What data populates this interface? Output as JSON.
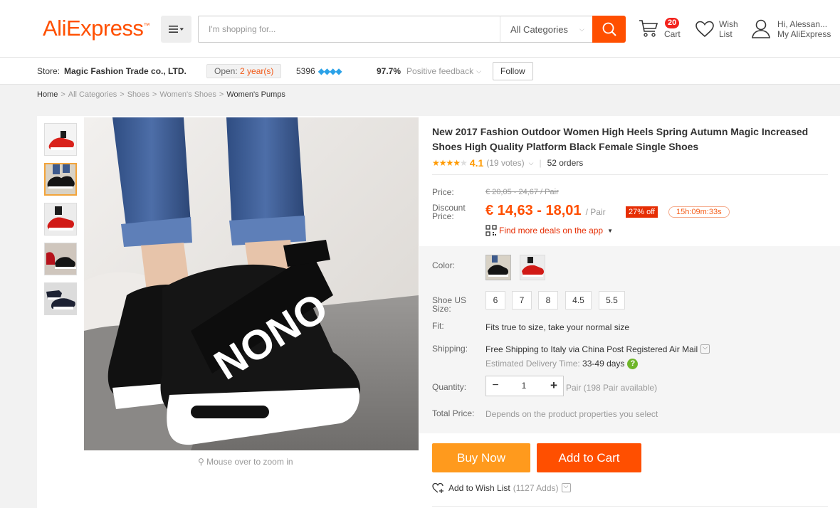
{
  "header": {
    "logo": "AliExpress",
    "search_placeholder": "I'm shopping for...",
    "search_category": "All Categories",
    "cart_count": "20",
    "cart_label": "Cart",
    "wish_line1": "Wish",
    "wish_line2": "List",
    "account_line1": "Hi, Alessan...",
    "account_line2": "My AliExpress"
  },
  "store": {
    "label": "Store:",
    "name": "Magic Fashion Trade co., LTD.",
    "open_prefix": "Open:",
    "open_years": "2 year(s)",
    "score": "5396",
    "diamonds": "💎💎💎💎",
    "feedback_pct": "97.7%",
    "feedback_label": "Positive feedback",
    "follow_label": "Follow"
  },
  "breadcrumb": [
    "Home",
    "All Categories",
    "Shoes",
    "Women's Shoes",
    "Women's Pumps"
  ],
  "gallery": {
    "zoom_hint": "Mouse over to zoom in",
    "thumb_count": 5
  },
  "product": {
    "title": "New 2017 Fashion Outdoor Women High Heels Spring Autumn Magic Increased Shoes High Quality Platform Black Female Single Shoes",
    "rating": 4.1,
    "rating_text": "4.1",
    "votes": "(19 votes)",
    "orders": "52 orders",
    "price_label": "Price:",
    "price_old": "€ 20,05 - 24,67 / Pair",
    "discount_label_1": "Discount",
    "discount_label_2": "Price:",
    "price_new": "€ 14,63 - 18,01",
    "per_pair": "/ Pair",
    "off_badge": "27% off",
    "timer": "15h:09m:33s",
    "app_deals": "Find more deals on the app",
    "color_label": "Color:",
    "size_label_1": "Shoe US",
    "size_label_2": "Size:",
    "sizes": [
      "6",
      "7",
      "8",
      "4.5",
      "5.5"
    ],
    "fit_label": "Fit:",
    "fit_value": "Fits true to size, take your normal size",
    "shipping_label": "Shipping:",
    "shipping_value": "Free Shipping to Italy via China Post Registered Air Mail",
    "delivery_prefix": "Estimated Delivery Time:",
    "delivery_days": "33-49 days",
    "quantity_label": "Quantity:",
    "quantity_value": "1",
    "available": "Pair (198 Pair available)",
    "total_label": "Total Price:",
    "total_value": "Depends on the product properties you select",
    "buy_now": "Buy Now",
    "add_to_cart": "Add to Cart",
    "wish_list": "Add to Wish List",
    "wish_adds": "(1127 Adds)"
  },
  "colors": {
    "brand": "#ff4f00",
    "buy_now": "#ff9a1d",
    "star": "#ff9a00",
    "discount_badge": "#e62e04"
  }
}
